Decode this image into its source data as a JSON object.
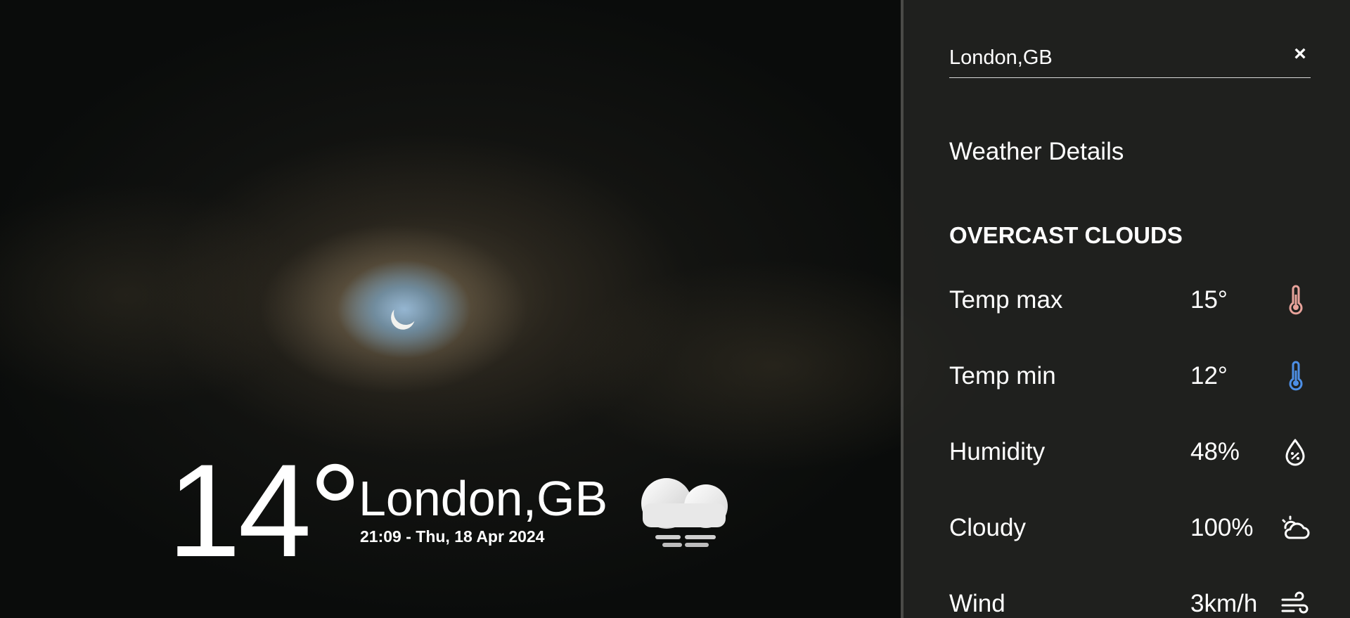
{
  "current": {
    "temperature": "14°",
    "city": "London,GB",
    "datetime": "21:09 - Thu, 18 Apr 2024",
    "icon": "cloud-fog-icon"
  },
  "search": {
    "value": "London,GB",
    "clear_label": "×"
  },
  "details": {
    "title": "Weather Details",
    "condition": "OVERCAST CLOUDS",
    "rows": [
      {
        "label": "Temp max",
        "value": "15°",
        "icon": "thermometer-hot-icon",
        "icon_color": "#e8a39b"
      },
      {
        "label": "Temp min",
        "value": "12°",
        "icon": "thermometer-cold-icon",
        "icon_color": "#4d8fe6"
      },
      {
        "label": "Humidity",
        "value": "48%",
        "icon": "humidity-drop-icon",
        "icon_color": "#ffffff"
      },
      {
        "label": "Cloudy",
        "value": "100%",
        "icon": "cloud-sun-icon",
        "icon_color": "#ffffff"
      },
      {
        "label": "Wind",
        "value": "3km/h",
        "icon": "wind-icon",
        "icon_color": "#ffffff"
      }
    ]
  }
}
